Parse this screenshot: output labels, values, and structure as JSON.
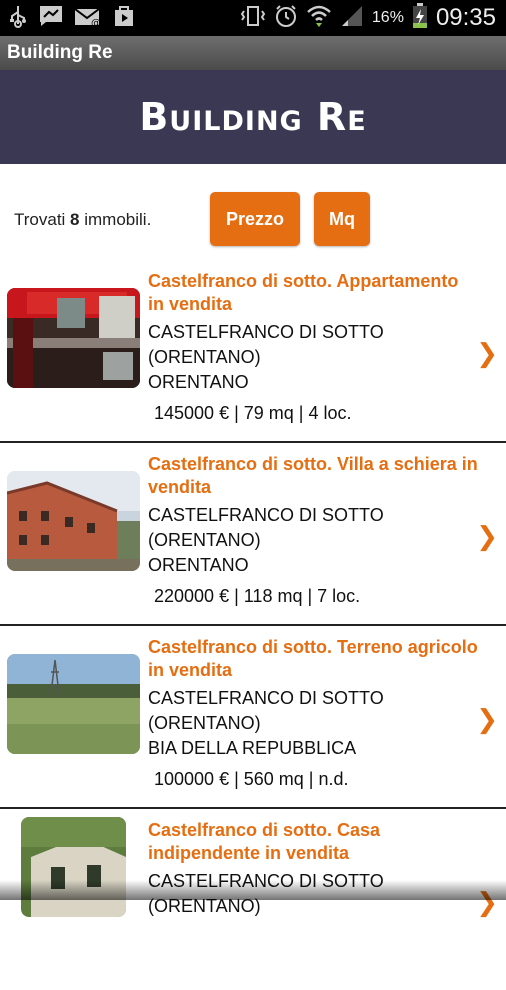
{
  "status_bar": {
    "battery_percent": "16%",
    "time": "09:35",
    "icons": [
      "usb-icon",
      "messenger-icon",
      "mail-icon",
      "play-store-icon",
      "vibrate-icon",
      "alarm-icon",
      "wifi-icon",
      "signal-icon",
      "battery-charging-icon"
    ]
  },
  "app": {
    "title": "Building Re",
    "logo_text": "Building Re"
  },
  "filters": {
    "found_prefix": "Trovati ",
    "found_count": "8",
    "found_suffix": " immobili.",
    "sort_price_label": "Prezzo",
    "sort_area_label": "Mq"
  },
  "listings": [
    {
      "title": "Castelfranco di sotto. Appartamento in vendita",
      "city": "CASTELFRANCO DI SOTTO (ORENTANO)",
      "locality": "ORENTANO",
      "details": "145000 € | 79 mq | 4 loc."
    },
    {
      "title": "Castelfranco di sotto. Villa a schiera in vendita",
      "city": "CASTELFRANCO DI SOTTO (ORENTANO)",
      "locality": "ORENTANO",
      "details": "220000 € | 118 mq | 7 loc."
    },
    {
      "title": "Castelfranco di sotto. Terreno agricolo in vendita",
      "city": "CASTELFRANCO DI SOTTO (ORENTANO)",
      "locality": "BIA DELLA REPUBBLICA",
      "details": "100000 € | 560 mq | n.d."
    },
    {
      "title": "Castelfranco di sotto. Casa indipendente in vendita",
      "city": "CASTELFRANCO DI SOTTO (ORENTANO)",
      "locality": "",
      "details": ""
    }
  ],
  "colors": {
    "accent": "#e56e12",
    "banner": "#3a3853",
    "titlebar": "#5a5a5a"
  }
}
